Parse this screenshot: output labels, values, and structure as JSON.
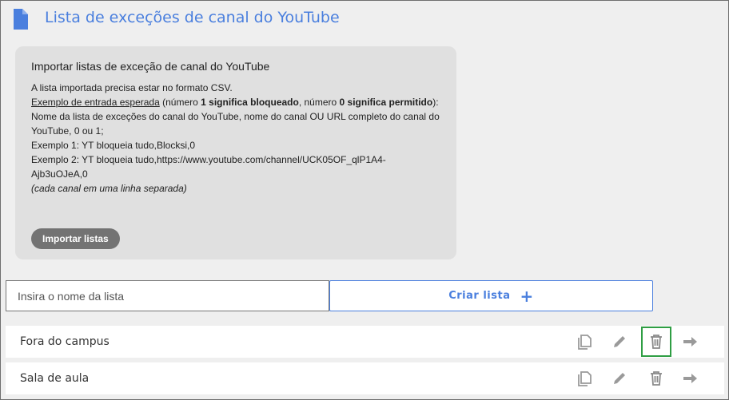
{
  "header": {
    "title": "Lista de exceções de canal do YouTube",
    "icon": "document-icon"
  },
  "import_box": {
    "title": "Importar listas de exceção de canal do YouTube",
    "line1": "A lista importada precisa estar no formato CSV.",
    "example_link": "Exemplo de entrada esperada",
    "note_a": " (número ",
    "note_b": "1 significa bloqueado",
    "note_c": ", número ",
    "note_d": "0 significa permitido",
    "note_e": "):",
    "format": "Nome da lista de exceções do canal do YouTube, nome do canal OU URL completo do canal do YouTube, 0 ou 1;",
    "example1": "Exemplo 1: YT bloqueia tudo,Blocksi,0",
    "example2": "Exemplo 2: YT bloqueia tudo,https://www.youtube.com/channel/UCK05OF_qlP1A4-Ajb3uOJeA,0",
    "hint": "(cada canal em uma linha separada)",
    "import_button": "Importar listas"
  },
  "create": {
    "input_placeholder": "Insira o nome da lista",
    "input_value": "",
    "button_label": "Criar lista",
    "button_icon": "plus-icon"
  },
  "lists": [
    {
      "name": "Fora do campus"
    },
    {
      "name": "Sala de aula"
    }
  ],
  "row_actions": [
    "copy-icon",
    "edit-icon",
    "trash-icon",
    "arrow-right-icon"
  ],
  "colors": {
    "accent": "#4a7fde",
    "icon_gray": "#9a9a9a",
    "selected": "#2f9e44"
  }
}
